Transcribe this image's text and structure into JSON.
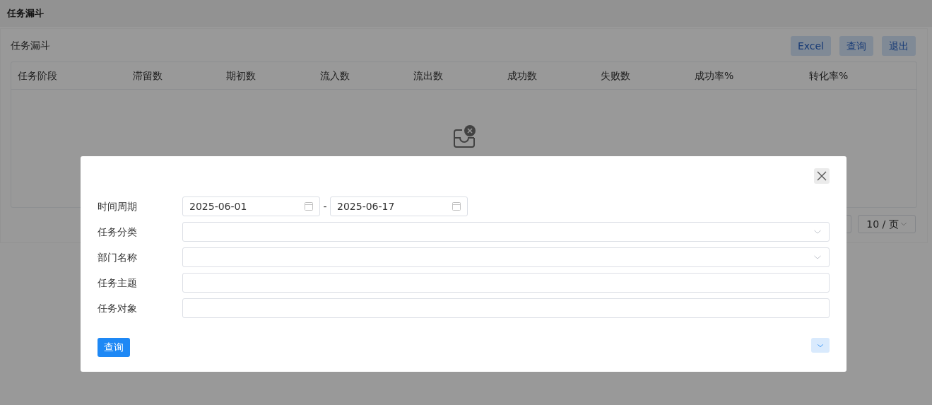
{
  "header": {
    "title": "任务漏斗"
  },
  "panel": {
    "title": "任务漏斗",
    "buttons": [
      "Excel",
      "查询",
      "退出"
    ]
  },
  "table": {
    "columns": [
      "任务阶段",
      "滞留数",
      "期初数",
      "流入数",
      "流出数",
      "成功数",
      "失败数",
      "成功率%",
      "转化率%"
    ]
  },
  "pagination": {
    "page_size": "10 / 页"
  },
  "dialog": {
    "fields": [
      {
        "label": "时间周期",
        "kind": "date_range",
        "from": "2025-06-01",
        "to": "2025-06-17",
        "separator": "-"
      },
      {
        "label": "任务分类",
        "kind": "select"
      },
      {
        "label": "部门名称",
        "kind": "select"
      },
      {
        "label": "任务主题",
        "kind": "text"
      },
      {
        "label": "任务对象",
        "kind": "text"
      }
    ],
    "submit": "查询"
  }
}
